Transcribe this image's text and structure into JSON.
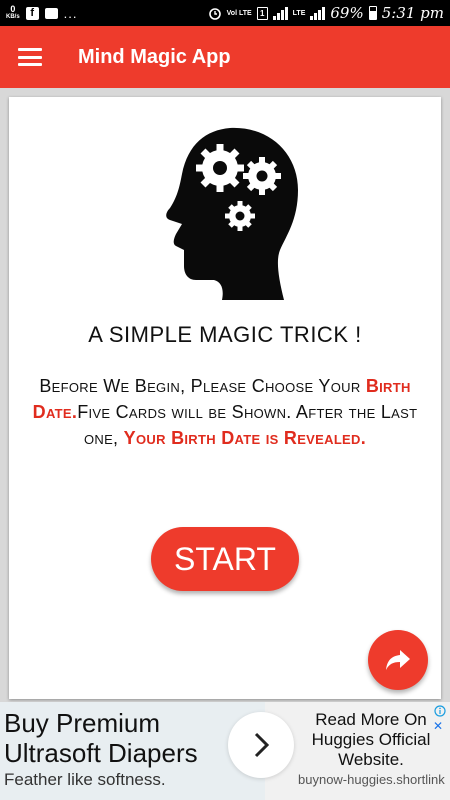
{
  "status_bar": {
    "speed": "0",
    "speed_unit": "KB/s",
    "dots": "...",
    "volte": "Vol LTE",
    "sim": "1",
    "lte": "LTE",
    "battery_percent": "69%",
    "time": "5:31 pm"
  },
  "app_bar": {
    "title": "Mind Magic App",
    "menu_icon": "hamburger-menu-icon"
  },
  "main": {
    "illustration_icon": "head-with-gears-icon",
    "title": "A SIMPLE MAGIC TRICK !",
    "description": {
      "part1": "Before We Begin, Please Choose Your ",
      "highlight1": "Birth Date.",
      "part2": "Five Cards will be Shown. After the Last one, ",
      "highlight2": "Your Birth Date is Revealed."
    },
    "start_label": "START",
    "share_icon": "share-arrow-icon"
  },
  "ad": {
    "headline": "Buy Premium Ultrasoft Diapers",
    "subtext": "Feather like softness.",
    "cta": "Read More On Huggies Official Website.",
    "url": "buynow-huggies.shortlink",
    "arrow_icon": "chevron-right-icon",
    "close": "✕"
  },
  "colors": {
    "accent": "#ee3b2c",
    "highlight_text": "#e02c1e"
  }
}
